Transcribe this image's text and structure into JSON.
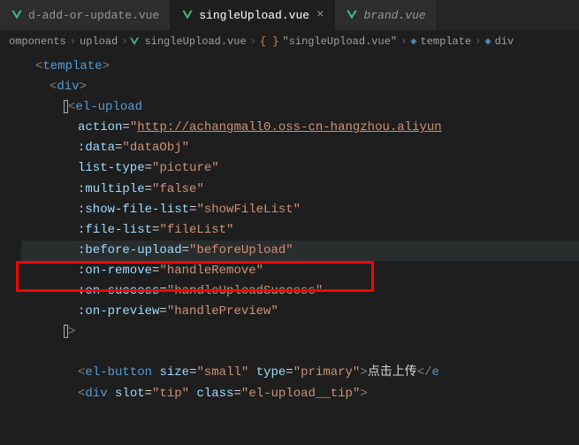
{
  "tabs": [
    {
      "label": "d-add-or-update.vue"
    },
    {
      "label": "singleUpload.vue"
    },
    {
      "label": "brand.vue"
    }
  ],
  "breadcrumb": {
    "p0": "omponents",
    "p1": "upload",
    "p2": "singleUpload.vue",
    "p3": "\"singleUpload.vue\"",
    "p4": "template",
    "p5": "div",
    "braces": "{ }"
  },
  "code": {
    "tag_template": "template",
    "tag_div": "div",
    "tag_elupload": "el-upload",
    "attr_action": "action",
    "val_action": "http://achangmall0.oss-cn-hangzhou.aliyun",
    "attr_data": ":data",
    "val_data": "dataObj",
    "attr_listtype": "list-type",
    "val_listtype": "picture",
    "attr_multiple": ":multiple",
    "val_multiple": "false",
    "attr_showfilelist": ":show-file-list",
    "val_showfilelist": "showFileList",
    "attr_filelist": ":file-list",
    "val_filelist": "fileList",
    "attr_beforeupload": ":before-upload",
    "val_beforeupload": "beforeUpload",
    "attr_onremove": ":on-remove",
    "val_onremove": "handleRemove",
    "attr_onsuccess": ":on-success",
    "val_onsuccess": "handleUploadSuccess",
    "attr_onpreview": ":on-preview",
    "val_onpreview": "handlePreview",
    "tag_elbutton": "el-button",
    "attr_size": "size",
    "val_size": "small",
    "attr_type": "type",
    "val_type": "primary",
    "txt_button": "点击上传",
    "attr_slot": "slot",
    "val_slot": "tip",
    "attr_class": "class",
    "val_class": "el-upload__tip"
  }
}
